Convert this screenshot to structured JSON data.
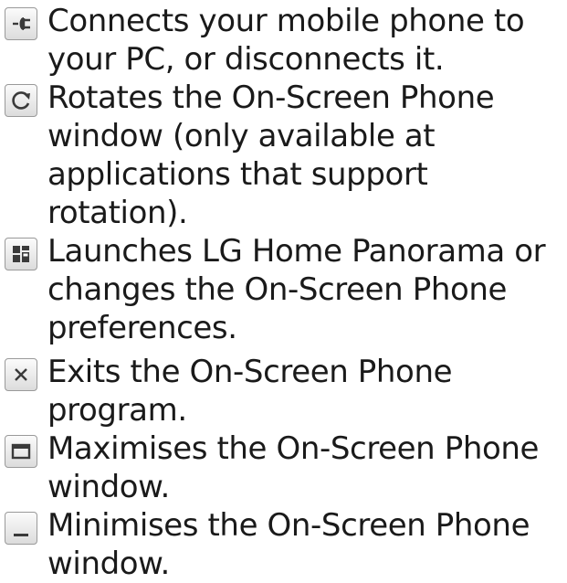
{
  "items": [
    {
      "icon": "connect-plug-icon",
      "text": "Connects your mobile phone to your PC, or disconnects it."
    },
    {
      "icon": "rotate-icon",
      "text": "Rotates the On-Screen Phone window (only available at applications that support rotation)."
    },
    {
      "icon": "home-panorama-grid-icon",
      "text": "Launches LG Home Panorama or changes the On-Screen Phone preferences."
    },
    {
      "icon": "close-icon",
      "text": "Exits the On-Screen Phone program."
    },
    {
      "icon": "maximise-icon",
      "text": "Maximises the On-Screen Phone window."
    },
    {
      "icon": "minimise-icon",
      "text": "Minimises the On-Screen Phone window."
    }
  ],
  "colors": {
    "text": "#1a1a1a",
    "icon_glyph": "#3a3a3a",
    "icon_border": "#9a9a9a"
  }
}
